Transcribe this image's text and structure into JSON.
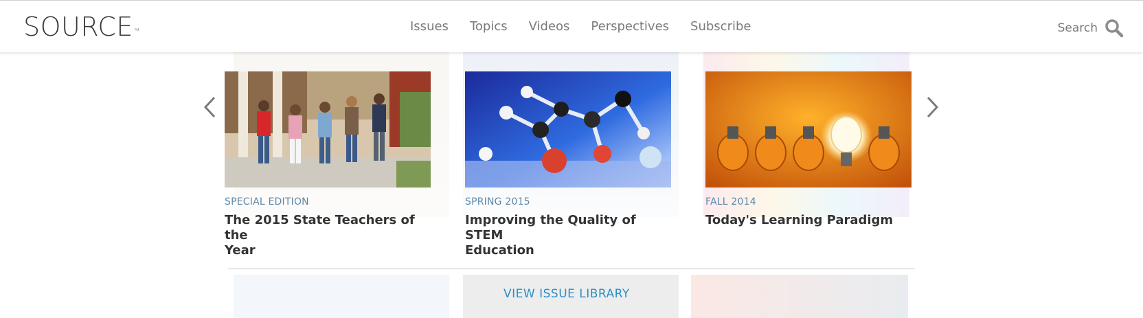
{
  "header": {
    "logo_text": "SOURCE",
    "logo_tm": "™",
    "nav": [
      {
        "label": "Issues"
      },
      {
        "label": "Topics"
      },
      {
        "label": "Videos"
      },
      {
        "label": "Perspectives"
      },
      {
        "label": "Subscribe"
      }
    ],
    "search_label": "Search",
    "search_icon": "magnifier-icon"
  },
  "carousel": {
    "prev_icon": "chevron-left-icon",
    "next_icon": "chevron-right-icon",
    "cards": [
      {
        "edition": "SPECIAL EDITION",
        "title_line1": "The 2015 State Teachers of the",
        "title_line2": "Year",
        "image": "children-running-photo"
      },
      {
        "edition": "SPRING 2015",
        "title_line1": "Improving the Quality of STEM",
        "title_line2": "Education",
        "image": "molecule-model-photo"
      },
      {
        "edition": "FALL 2014",
        "title_line1": "Today's Learning Paradigm",
        "title_line2": "",
        "image": "light-bulbs-photo"
      }
    ]
  },
  "footer": {
    "library_link": "VIEW ISSUE LIBRARY"
  },
  "colors": {
    "accent_link": "#2a8fc4",
    "edition_label": "#5c87a8",
    "nav_text": "#7a7a7a"
  }
}
